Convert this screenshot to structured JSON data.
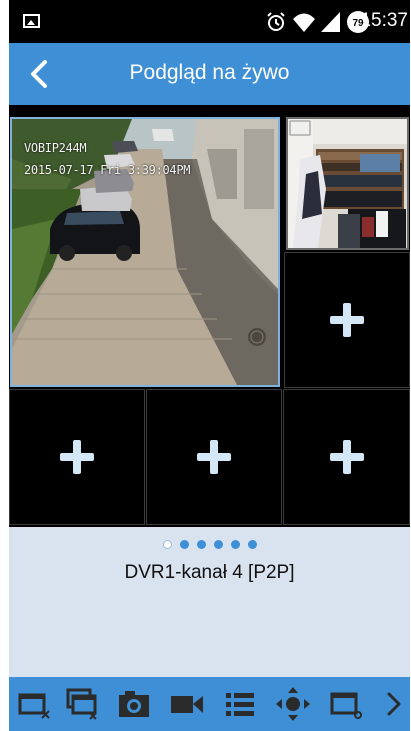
{
  "status_bar": {
    "time": "15:37",
    "notification_badge": "79",
    "icons": [
      "gallery-icon",
      "alarm-icon",
      "wifi-icon",
      "signal-icon",
      "notification-badge-icon"
    ]
  },
  "header": {
    "title": "Podgląd na żywo",
    "back_icon": "chevron-left-icon"
  },
  "grid": {
    "camera_main": {
      "osd_name": "VOBIP244M",
      "osd_datetime": "2015-07-17 Fri 3:39:04PM"
    },
    "empty_slot_icon": "plus-icon",
    "empty_slots": 4
  },
  "pager": {
    "pages": 6,
    "active_index": 0
  },
  "channel": {
    "label": "DVR1-kanał 4 [P2P]"
  },
  "toolbar": {
    "items": [
      "close-window-icon",
      "close-all-windows-icon",
      "snapshot-icon",
      "record-icon",
      "list-icon",
      "ptz-control-icon",
      "window-settings-icon",
      "more-icon"
    ]
  },
  "colors": {
    "accent": "#3f8fd6",
    "background": "#d9e3ef",
    "video_background": "#000000",
    "selected_border": "#7fb3dd"
  }
}
